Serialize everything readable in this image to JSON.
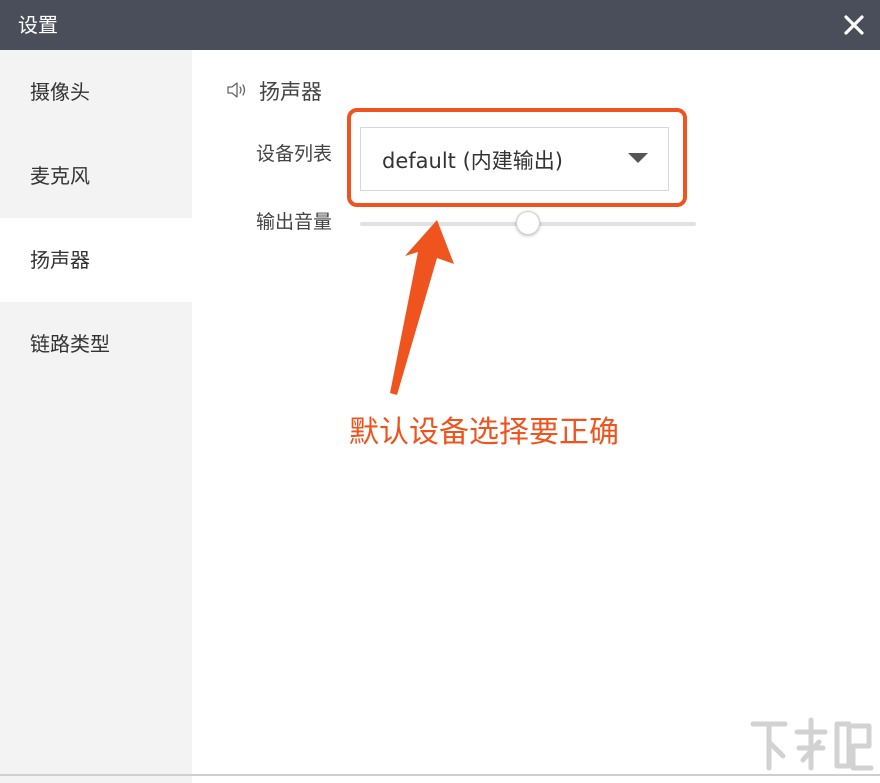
{
  "window": {
    "title": "设置",
    "close_icon": "close-icon"
  },
  "sidebar": {
    "items": [
      {
        "label": "摄像头",
        "active": false
      },
      {
        "label": "麦克风",
        "active": false
      },
      {
        "label": "扬声器",
        "active": true
      },
      {
        "label": "链路类型",
        "active": false
      }
    ]
  },
  "speaker": {
    "section_icon": "speaker-icon",
    "section_title": "扬声器",
    "device_list_label": "设备列表",
    "device_selected": "default (内建输出)",
    "volume_label": "输出音量",
    "volume_fraction": 0.5
  },
  "annotation": {
    "text": "默认设备选择要正确",
    "color": "#f0541e"
  },
  "colors": {
    "titlebar": "#4a4d5a",
    "sidebar": "#f3f3f4",
    "accent": "#f0541e"
  }
}
